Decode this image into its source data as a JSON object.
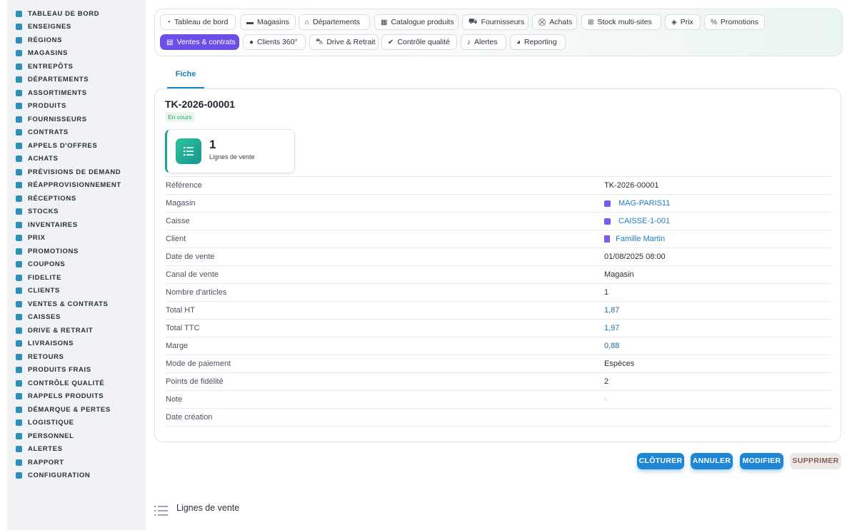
{
  "sidebar": {
    "items": [
      {
        "label": "TABLEAU DE BORD",
        "icon": "dashboard-icon"
      },
      {
        "label": "ENSEIGNES",
        "icon": "flag-icon"
      },
      {
        "label": "RÉGIONS",
        "icon": "map-icon"
      },
      {
        "label": "MAGASINS",
        "icon": "store-icon"
      },
      {
        "label": "ENTREPÔTS",
        "icon": "warehouse-icon"
      },
      {
        "label": "DÉPARTEMENTS",
        "icon": "basket-icon"
      },
      {
        "label": "ASSORTIMENTS",
        "icon": "assortment-icon"
      },
      {
        "label": "PRODUITS",
        "icon": "box-icon"
      },
      {
        "label": "FOURNISSEURS",
        "icon": "supplier-icon"
      },
      {
        "label": "CONTRATS",
        "icon": "contract-icon"
      },
      {
        "label": "APPELS D'OFFRES",
        "icon": "gavel-icon"
      },
      {
        "label": "ACHATS",
        "icon": "cart-icon"
      },
      {
        "label": "PRÉVISIONS DE DEMAND",
        "icon": "chart-icon"
      },
      {
        "label": "RÉAPPROVISIONNEMENT",
        "icon": "refresh-icon"
      },
      {
        "label": "RÉCEPTIONS",
        "icon": "inbox-icon"
      },
      {
        "label": "STOCKS",
        "icon": "stock-icon"
      },
      {
        "label": "INVENTAIRES",
        "icon": "clipboard-icon"
      },
      {
        "label": "PRIX",
        "icon": "tag-icon"
      },
      {
        "label": "PROMOTIONS",
        "icon": "percent-icon"
      },
      {
        "label": "COUPONS",
        "icon": "coupon-icon"
      },
      {
        "label": "FIDELITE",
        "icon": "card-icon"
      },
      {
        "label": "CLIENTS",
        "icon": "user-icon"
      },
      {
        "label": "VENTES & CONTRATS",
        "icon": "receipt-icon"
      },
      {
        "label": "CAISSES",
        "icon": "register-icon"
      },
      {
        "label": "DRIVE & RETRAIT",
        "icon": "car-icon"
      },
      {
        "label": "LIVRAISONS",
        "icon": "truck-icon"
      },
      {
        "label": "RETOURS",
        "icon": "return-icon"
      },
      {
        "label": "PRODUITS FRAIS",
        "icon": "leaf-icon"
      },
      {
        "label": "CONTRÔLE QUALITÉ",
        "icon": "check-icon"
      },
      {
        "label": "RAPPELS PRODUITS",
        "icon": "warning-icon"
      },
      {
        "label": "DÉMARQUE & PERTES",
        "icon": "trash-icon"
      },
      {
        "label": "LOGISTIQUE",
        "icon": "logistics-icon"
      },
      {
        "label": "PERSONNEL",
        "icon": "people-icon"
      },
      {
        "label": "ALERTES",
        "icon": "bell-icon"
      },
      {
        "label": "RAPPORT",
        "icon": "report-icon"
      },
      {
        "label": "CONFIGURATION",
        "icon": "gear-icon"
      }
    ]
  },
  "tabs": [
    {
      "label": "Tableau de bord",
      "glyph": "◔",
      "active": false
    },
    {
      "label": "Magasins",
      "glyph": "▬",
      "active": false
    },
    {
      "label": "Départements",
      "glyph": "⌂",
      "active": false
    },
    {
      "label": "Catalogue produits",
      "glyph": "▦",
      "active": false
    },
    {
      "label": "Fournisseurs",
      "glyph": "⛟",
      "active": false
    },
    {
      "label": "Achats",
      "glyph": "⛒",
      "active": false
    },
    {
      "label": "Stock multi-sites",
      "glyph": "⊞",
      "active": false
    },
    {
      "label": "Prix",
      "glyph": "◈",
      "active": false
    },
    {
      "label": "Promotions",
      "glyph": "%",
      "active": false
    },
    {
      "label": "Ventes & contrats",
      "glyph": "▤",
      "active": true
    },
    {
      "label": "Clients 360°",
      "glyph": "●",
      "active": false
    },
    {
      "label": "Drive & Retrait",
      "glyph": "⛍",
      "active": false
    },
    {
      "label": "Contrôle qualité",
      "glyph": "✔",
      "active": false
    },
    {
      "label": "Alertes",
      "glyph": "♪",
      "active": false
    },
    {
      "label": "Reporting",
      "glyph": "◕",
      "active": false
    }
  ],
  "subtab": {
    "label": "Fiche"
  },
  "record": {
    "title": "TK-2026-00001",
    "status": "En cours",
    "status_color": "#28a361",
    "stat": {
      "value": "1",
      "label": "Lignes de vente"
    },
    "fields": [
      {
        "label": "Référence",
        "value": "TK-2026-00001",
        "kind": "text"
      },
      {
        "label": "Magasin",
        "value": "MAG-PARIS11",
        "kind": "link-pill"
      },
      {
        "label": "Caisse",
        "value": "CAISSE-1-001",
        "kind": "link-pill"
      },
      {
        "label": "Client",
        "value": "Famille Martin",
        "kind": "link-building"
      },
      {
        "label": "Date de vente",
        "value": "01/08/2025 08:00",
        "kind": "text"
      },
      {
        "label": "Canal de vente",
        "value": "Magasin",
        "kind": "text"
      },
      {
        "label": "Nombre d'articles",
        "value": "1",
        "kind": "text"
      },
      {
        "label": "Total HT",
        "value": "1,87",
        "kind": "num"
      },
      {
        "label": "Total TTC",
        "value": "1,97",
        "kind": "num"
      },
      {
        "label": "Marge",
        "value": "0,88",
        "kind": "num"
      },
      {
        "label": "Mode de paiement",
        "value": "Espèces",
        "kind": "text"
      },
      {
        "label": "Points de fidélité",
        "value": "2",
        "kind": "text"
      },
      {
        "label": "Note",
        "value": "-",
        "kind": "muted"
      },
      {
        "label": "Date création",
        "value": "",
        "kind": "text"
      }
    ]
  },
  "actions": {
    "close_label": "CLÔTURER",
    "cancel_label": "ANNULER",
    "edit_label": "MODIFIER",
    "delete_label": "SUPPRIMER"
  },
  "lines_section": {
    "title": "Lignes de vente"
  },
  "colors": {
    "accent": "#6c4fe8",
    "primary": "#1f86d6",
    "sidebar_icon": "#2e8fb8"
  }
}
